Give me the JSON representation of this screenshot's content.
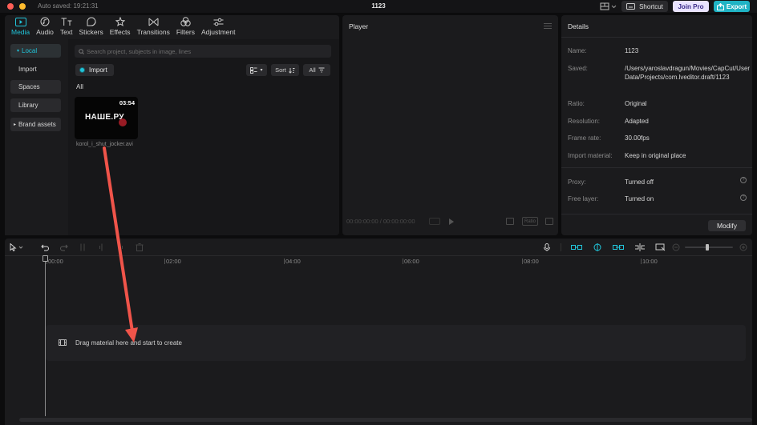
{
  "titlebar": {
    "autosave": "Auto saved: 19:21:31",
    "title": "1123",
    "shortcut_label": "Shortcut",
    "joinpro_label": "Join Pro",
    "export_label": "Export"
  },
  "media": {
    "tabs": [
      {
        "label": "Media",
        "icon": "media-icon"
      },
      {
        "label": "Audio",
        "icon": "audio-icon"
      },
      {
        "label": "Text",
        "icon": "text-icon"
      },
      {
        "label": "Stickers",
        "icon": "stickers-icon"
      },
      {
        "label": "Effects",
        "icon": "effects-icon"
      },
      {
        "label": "Transitions",
        "icon": "transitions-icon"
      },
      {
        "label": "Filters",
        "icon": "filters-icon"
      },
      {
        "label": "Adjustment",
        "icon": "adjustment-icon"
      }
    ],
    "sidebar": [
      "Local",
      "Import",
      "Spaces",
      "Library",
      "Brand assets"
    ],
    "search_placeholder": "Search project, subjects in image, lines",
    "import_label": "Import",
    "sort_label": "Sort",
    "filter_label": "All",
    "all_label": "All",
    "clip": {
      "logo_text": "НАШЕ.РУ",
      "duration": "03:54",
      "filename": "korol_i_shut_jocker.avi"
    }
  },
  "player": {
    "title": "Player",
    "time": "00:00:00:00 / 00:00:00:00",
    "ratio_label": "Ratio"
  },
  "details": {
    "title": "Details",
    "rows": [
      {
        "label": "Name:",
        "value": "1123"
      },
      {
        "label": "Saved:",
        "value": "/Users/yaroslavdragun/Movies/CapCut/User Data/Projects/com.lveditor.draft/1123"
      },
      {
        "label": "Ratio:",
        "value": "Original"
      },
      {
        "label": "Resolution:",
        "value": "Adapted"
      },
      {
        "label": "Frame rate:",
        "value": "30.00fps"
      },
      {
        "label": "Import material:",
        "value": "Keep in original place"
      },
      {
        "label": "Proxy:",
        "value": "Turned off"
      },
      {
        "label": "Free layer:",
        "value": "Turned on"
      }
    ],
    "modify_label": "Modify"
  },
  "timeline": {
    "ticks": [
      "00:00",
      "02:00",
      "04:00",
      "06:00",
      "08:00",
      "10:00"
    ],
    "drop_text": "Drag material here and start to create"
  },
  "colors": {
    "accent": "#21c4d9",
    "annotation_arrow": "#f0544a",
    "joinpro_bg": "#e9e3ff",
    "export_bg": "#1fb3c4"
  }
}
